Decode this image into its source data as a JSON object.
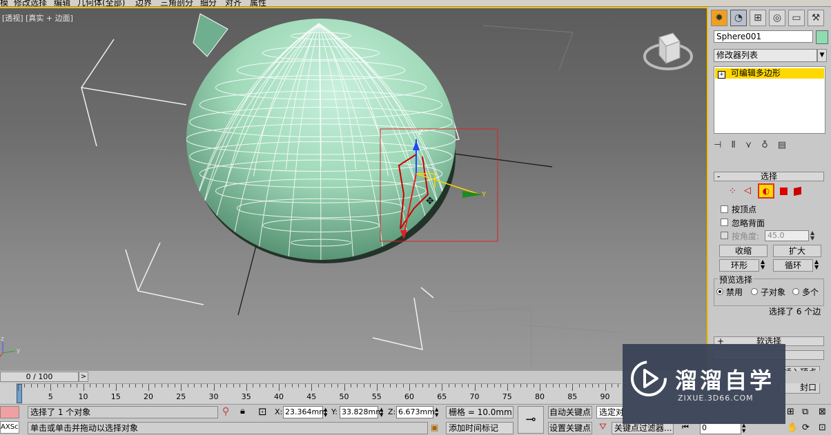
{
  "menubar": {
    "items": [
      "模",
      "修改选择",
      "编辑",
      "几何体(全部)",
      "边界",
      "三角剖分",
      "细分",
      "对齐",
      "属性"
    ]
  },
  "viewport": {
    "label": "[透视] [真实 + 边面]",
    "axis_z": "z",
    "axis_y": "y",
    "gizmo_z": "Z",
    "gizmo_y": "Y"
  },
  "command_panel": {
    "object_name": "Sphere001",
    "modifier_list": "修改器列表",
    "stack_item": "可编辑多边形",
    "selection_rollout": {
      "header": "选择",
      "by_vertex": "按顶点",
      "ignore_backfacing": "忽略背面",
      "by_angle": "按角度:",
      "angle_value": "45.0",
      "shrink": "收缩",
      "grow": "扩大",
      "ring": "环形",
      "loop": "循环",
      "preview_selection": "预览选择",
      "preview_disabled": "禁用",
      "preview_subobject": "子对象",
      "preview_multi": "多个",
      "selection_info": "选择了 6 个边"
    },
    "soft_selection_header": "软选择",
    "insert_vertex": "插入顶点",
    "cap": "封口"
  },
  "timeline": {
    "frame_counter": "0 / 100",
    "next_arrow": ">",
    "ticks": [
      "5",
      "10",
      "15",
      "20",
      "25",
      "30",
      "35",
      "40",
      "45",
      "50",
      "55",
      "60",
      "65",
      "70",
      "75",
      "80",
      "85",
      "90"
    ]
  },
  "status": {
    "maxscript": "AXSci",
    "selection_status": "选择了 1 个对象",
    "prompt": "单击或单击并拖动以选择对象",
    "x_label": "X:",
    "x_value": "23.364mm",
    "y_label": "Y:",
    "y_value": "33.828mm",
    "z_label": "Z:",
    "z_value": "6.673mm",
    "grid": "栅格 = 10.0mm",
    "add_time_tag": "添加时间标记",
    "auto_key": "自动关键点",
    "set_key": "设置关键点",
    "selected_object": "选定对",
    "key_filters": "关键点过滤器...",
    "frame_value": "0"
  },
  "watermark": {
    "brand": "溜溜自学",
    "url": "ZIXUE.3D66.COM"
  },
  "colors": {
    "active_border": "#f0c000",
    "sphere": "#9fd9b8",
    "stack_highlight": "#ffd800"
  }
}
